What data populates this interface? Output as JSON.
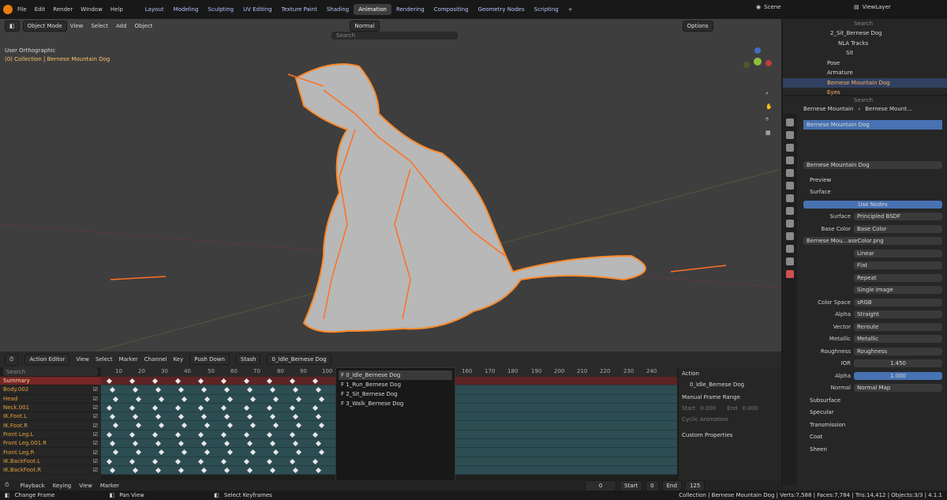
{
  "topbar": {
    "menus": [
      "File",
      "Edit",
      "Render",
      "Window",
      "Help"
    ],
    "workspaces": [
      "Layout",
      "Modeling",
      "Sculpting",
      "UV Editing",
      "Texture Paint",
      "Shading",
      "Animation",
      "Rendering",
      "Compositing",
      "Geometry Nodes",
      "Scripting"
    ],
    "active_workspace": "Animation",
    "scene": "Scene",
    "view_layer": "ViewLayer"
  },
  "viewport": {
    "mode": "Object Mode",
    "menus": [
      "View",
      "Select",
      "Add",
      "Object"
    ],
    "orientation": "Normal",
    "options": "Options",
    "search_placeholder": "Search",
    "view_name": "User Orthographic",
    "collection_info": "(0) Collection | Bernese Mountain Dog"
  },
  "action_editor": {
    "type": "Action Editor",
    "menus": [
      "View",
      "Select",
      "Marker",
      "Channel",
      "Key"
    ],
    "push_down": "Push Down",
    "stash": "Stash",
    "action_name": "0_Idle_Bernese Dog",
    "search_placeholder": "Search",
    "ticks": [
      "10",
      "20",
      "30",
      "40",
      "50",
      "60",
      "70",
      "80",
      "90",
      "100",
      "160",
      "170",
      "180",
      "190",
      "200",
      "210",
      "220",
      "230",
      "240"
    ],
    "channels": [
      "Summary",
      "Body.002",
      "Head",
      "Neck.001",
      "IK.Foot.L",
      "IK.Foot.R",
      "Front Leg.L",
      "Front Leg.001.R",
      "Front Leg.R",
      "IK.BackFoot.L",
      "IK.BackFoot.R"
    ],
    "action_list": [
      "F 0_Idle_Bernese Dog",
      "F 1_Run_Bernese Dog",
      "F 2_Sit_Bernese Dog",
      "F 3_Walk_Bernese Dog"
    ],
    "panel": {
      "title": "Action",
      "action": "0_Idle_Bernese Dog",
      "manual_range": "Manual Frame Range",
      "start_label": "Start",
      "start_val": "0.000",
      "end_label": "End",
      "end_val": "0.000",
      "cyclic": "Cyclic Animation",
      "custom": "Custom Properties"
    }
  },
  "playback": {
    "menus": [
      "Playback",
      "Keying",
      "View",
      "Marker"
    ],
    "current": "0",
    "start_label": "Start",
    "start": "0",
    "end_label": "End",
    "end": "125"
  },
  "status": {
    "left1": "Change Frame",
    "left2": "Pan View",
    "left3": "Select Keyframes",
    "right": "Collection | Bernese Mountain Dog | Verts:7,588 | Faces:7,784 | Tris:14,412 | Objects:3/3 | 4.1.1"
  },
  "outliner": {
    "search_placeholder": "Search",
    "items": [
      "2_Sit_Bernese Dog",
      "NLA Tracks",
      "Sit",
      "Pose",
      "Armature",
      "Bernese Mountain Dog",
      "Eyes"
    ]
  },
  "properties": {
    "breadcrumb1": "Bernese Mountain",
    "breadcrumb2": "Bernese Mount...",
    "search_placeholder": "Search",
    "material_slot": "Bernese Mountain Dog",
    "material_name": "Bernese Mountain Dog",
    "preview": "Preview",
    "surface_section": "Surface",
    "use_nodes": "Use Nodes",
    "surface_label": "Surface",
    "surface_val": "Principled BSDF",
    "base_color_label": "Base Color",
    "base_color_val": "Base Color",
    "image_name": "Bernese Mou...aseColor.png",
    "interp": "Linear",
    "proj": "Flat",
    "ext": "Repeat",
    "src": "Single Image",
    "colorspace_label": "Color Space",
    "colorspace_val": "sRGB",
    "alpha_label": "Alpha",
    "alpha_val": "Straight",
    "vector_label": "Vector",
    "vector_val": "Reroute",
    "metallic_label": "Metallic",
    "metallic_val": "Metallic",
    "roughness_label": "Roughness",
    "roughness_val": "Roughness",
    "ior_label": "IOR",
    "ior_val": "1.450",
    "alpha2_label": "Alpha",
    "alpha2_val": "1.000",
    "normal_label": "Normal",
    "normal_val": "Normal Map",
    "subs": [
      "Subsurface",
      "Specular",
      "Transmission",
      "Coat",
      "Sheen"
    ]
  }
}
